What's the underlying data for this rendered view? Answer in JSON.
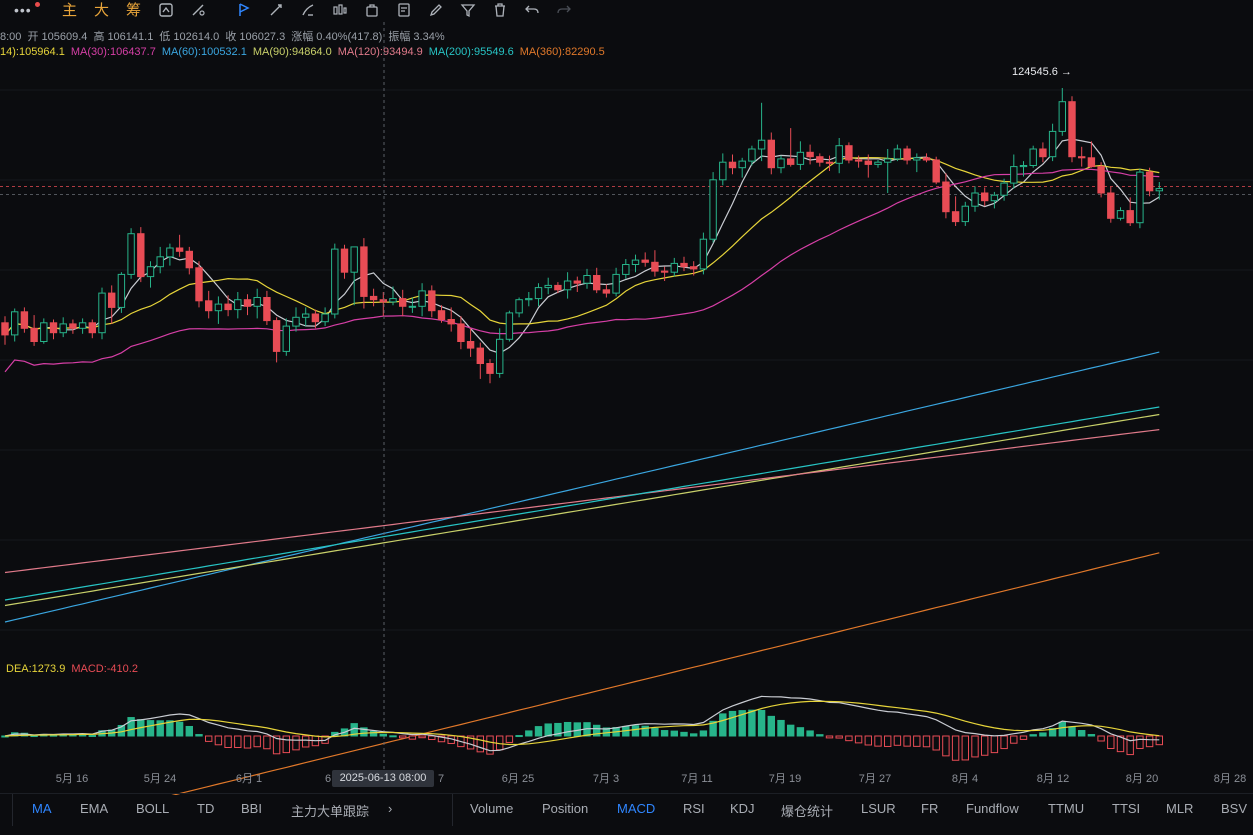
{
  "toolbar": {
    "more_label": "•••",
    "cn_items": [
      "主",
      "大",
      "筹"
    ],
    "icons": [
      "target-icon",
      "pen-line-icon",
      "indicator-icon",
      "draw-line-icon",
      "magnet-icon",
      "ruler-icon",
      "highlighter-icon",
      "candles-icon",
      "bag-icon",
      "note-icon",
      "pencil-icon",
      "filter-icon",
      "trash-icon",
      "undo-icon",
      "redo-icon"
    ]
  },
  "ohlc": {
    "time": "8:00",
    "open_label": "开",
    "open": "105609.4",
    "high_label": "高",
    "high": "106141.1",
    "low_label": "低",
    "low": "102614.0",
    "close_label": "收",
    "close": "106027.3",
    "change_label": "涨幅",
    "change": "0.40%(417.8)",
    "amp_label": "振幅",
    "amp": "3.34%"
  },
  "ma_legend": [
    {
      "label": "14):105964.1",
      "color": "#e6d43a"
    },
    {
      "label": "MA(30):106437.7",
      "color": "#d63fa6"
    },
    {
      "label": "MA(60):100532.1",
      "color": "#3aa6e0"
    },
    {
      "label": "MA(90):94864.0",
      "color": "#c8d06a"
    },
    {
      "label": "MA(120):93494.9",
      "color": "#e07a8a"
    },
    {
      "label": "MA(200):95549.6",
      "color": "#27c4c4"
    },
    {
      "label": "MA(360):82290.5",
      "color": "#e0782a"
    }
  ],
  "macd_legend": [
    {
      "label": "DEA:1273.9",
      "color": "#e6d43a"
    },
    {
      "label": "MACD:-410.2",
      "color": "#e84c55"
    }
  ],
  "peak_label": "124545.6 →",
  "crosshair_date": "2025-06-13 08:00",
  "chart_data": {
    "type": "candlestick",
    "x_labels": [
      "5月 16",
      "5月 24",
      "6月 1",
      "6",
      "7",
      "6月 25",
      "7月 3",
      "7月 11",
      "7月 19",
      "7月 27",
      "8月 4",
      "8月 12",
      "8月 20",
      "8月 28"
    ],
    "ma_current": [
      {
        "name": "MA(30)",
        "value": 106437.7
      },
      {
        "name": "MA(60)",
        "value": 100532.1
      },
      {
        "name": "MA(90)",
        "value": 94864.0
      },
      {
        "name": "MA(120)",
        "value": 93494.9
      },
      {
        "name": "MA(200)",
        "value": 95549.6
      },
      {
        "name": "MA(360)",
        "value": 82290.5
      }
    ],
    "last_candle": {
      "open": 105609.4,
      "high": 106141.1,
      "low": 102614.0,
      "close": 106027.3
    },
    "high_marker": 124545.6,
    "candles": [
      [
        103200,
        103800,
        101200,
        102100
      ],
      [
        102100,
        104500,
        101500,
        104200
      ],
      [
        104200,
        104600,
        102300,
        102700
      ],
      [
        102700,
        103900,
        101100,
        101500
      ],
      [
        101500,
        103600,
        101300,
        103200
      ],
      [
        103200,
        103500,
        101700,
        102300
      ],
      [
        102300,
        103700,
        101900,
        103100
      ],
      [
        103100,
        103500,
        102200,
        102700
      ],
      [
        102700,
        103600,
        102200,
        103200
      ],
      [
        103200,
        103500,
        101800,
        102300
      ],
      [
        102300,
        106400,
        101700,
        105900
      ],
      [
        105900,
        106600,
        103100,
        104600
      ],
      [
        104600,
        107800,
        104100,
        107600
      ],
      [
        107600,
        111800,
        107200,
        111300
      ],
      [
        111300,
        111900,
        106900,
        107400
      ],
      [
        107400,
        108800,
        106400,
        108300
      ],
      [
        108300,
        110100,
        107700,
        109200
      ],
      [
        109200,
        110400,
        108400,
        110000
      ],
      [
        110000,
        111200,
        109200,
        109700
      ],
      [
        109700,
        110100,
        107600,
        108200
      ],
      [
        108200,
        108800,
        104600,
        105200
      ],
      [
        105200,
        106100,
        103600,
        104300
      ],
      [
        104300,
        105600,
        103100,
        104900
      ],
      [
        104900,
        105700,
        103800,
        104400
      ],
      [
        104400,
        106000,
        103600,
        105300
      ],
      [
        105300,
        105800,
        103900,
        104700
      ],
      [
        104700,
        106300,
        103600,
        105500
      ],
      [
        105500,
        106100,
        103000,
        103400
      ],
      [
        103400,
        103700,
        99600,
        100600
      ],
      [
        100600,
        103600,
        100200,
        102900
      ],
      [
        102900,
        104600,
        102400,
        103700
      ],
      [
        103700,
        104600,
        102900,
        104000
      ],
      [
        104000,
        104400,
        102700,
        103300
      ],
      [
        103300,
        104600,
        102900,
        104000
      ],
      [
        104000,
        110400,
        103600,
        109900
      ],
      [
        109900,
        110300,
        107200,
        107800
      ],
      [
        107800,
        108500,
        104800,
        110100
      ],
      [
        110100,
        110900,
        104500,
        105600
      ],
      [
        105600,
        106300,
        104700,
        105300
      ],
      [
        105300,
        106000,
        103800,
        105100
      ],
      [
        105100,
        106500,
        104800,
        105400
      ],
      [
        105400,
        106200,
        103800,
        104700
      ],
      [
        104700,
        105500,
        104100,
        104700
      ],
      [
        104700,
        106800,
        103800,
        106100
      ],
      [
        106100,
        106600,
        103700,
        104300
      ],
      [
        104300,
        104800,
        103200,
        103500
      ],
      [
        103500,
        104600,
        102400,
        103100
      ],
      [
        103100,
        103800,
        100800,
        101500
      ],
      [
        101500,
        102700,
        100100,
        100900
      ],
      [
        100900,
        101400,
        98100,
        99500
      ],
      [
        99500,
        99900,
        97700,
        98600
      ],
      [
        98600,
        102700,
        98200,
        101700
      ],
      [
        101700,
        104300,
        101500,
        104100
      ],
      [
        104100,
        105500,
        103700,
        105300
      ],
      [
        105300,
        106000,
        104700,
        105400
      ],
      [
        105400,
        106800,
        104700,
        106400
      ],
      [
        106400,
        107300,
        105800,
        106600
      ],
      [
        106600,
        106900,
        105900,
        106200
      ],
      [
        106200,
        107800,
        105400,
        107000
      ],
      [
        107000,
        107400,
        106000,
        106800
      ],
      [
        106800,
        108100,
        106300,
        107500
      ],
      [
        107500,
        108200,
        105900,
        106200
      ],
      [
        106200,
        106700,
        105500,
        105900
      ],
      [
        105900,
        108200,
        105600,
        107600
      ],
      [
        107600,
        109000,
        107200,
        108500
      ],
      [
        108500,
        109400,
        107800,
        108900
      ],
      [
        108900,
        109600,
        108300,
        108700
      ],
      [
        108700,
        109800,
        107400,
        107900
      ],
      [
        107900,
        108300,
        107000,
        107800
      ],
      [
        107800,
        109100,
        107400,
        108600
      ],
      [
        108600,
        109200,
        107900,
        108300
      ],
      [
        108300,
        108800,
        107500,
        108100
      ],
      [
        108100,
        111400,
        107600,
        110800
      ],
      [
        110800,
        116900,
        110500,
        116200
      ],
      [
        116200,
        118600,
        115700,
        117800
      ],
      [
        117800,
        118500,
        116700,
        117300
      ],
      [
        117300,
        118200,
        116400,
        117900
      ],
      [
        117900,
        119300,
        117500,
        119000
      ],
      [
        119000,
        123200,
        117900,
        119800
      ],
      [
        119800,
        120500,
        116700,
        117300
      ],
      [
        117300,
        118400,
        116800,
        118100
      ],
      [
        118100,
        120900,
        117400,
        117600
      ],
      [
        117600,
        119700,
        117100,
        118700
      ],
      [
        118700,
        119400,
        117600,
        118300
      ],
      [
        118300,
        118600,
        117400,
        117800
      ],
      [
        117800,
        118400,
        117000,
        117700
      ],
      [
        117700,
        120000,
        116800,
        119300
      ],
      [
        119300,
        119600,
        117700,
        118000
      ],
      [
        118000,
        118400,
        117300,
        117900
      ],
      [
        117900,
        118500,
        116400,
        117600
      ],
      [
        117600,
        118000,
        117300,
        117800
      ],
      [
        117800,
        119000,
        115000,
        118100
      ],
      [
        118100,
        119400,
        117900,
        119000
      ],
      [
        119000,
        119300,
        117600,
        118000
      ],
      [
        118000,
        118600,
        116900,
        118200
      ],
      [
        118200,
        118600,
        117800,
        118000
      ],
      [
        118000,
        118300,
        115800,
        116000
      ],
      [
        116000,
        116800,
        112700,
        113300
      ],
      [
        113300,
        114700,
        112000,
        112400
      ],
      [
        112400,
        114200,
        112000,
        113800
      ],
      [
        113800,
        115600,
        113300,
        115000
      ],
      [
        115000,
        115500,
        113800,
        114300
      ],
      [
        114300,
        115100,
        113600,
        114800
      ],
      [
        114800,
        116300,
        114300,
        115900
      ],
      [
        115900,
        118500,
        115400,
        117400
      ],
      [
        117400,
        117900,
        116500,
        117500
      ],
      [
        117500,
        119300,
        117300,
        119000
      ],
      [
        119000,
        119600,
        117800,
        118300
      ],
      [
        118300,
        121300,
        117900,
        120600
      ],
      [
        120600,
        124545.6,
        120200,
        123300
      ],
      [
        123300,
        123800,
        117800,
        118300
      ],
      [
        118300,
        119200,
        117400,
        118200
      ],
      [
        118200,
        119700,
        117300,
        117400
      ],
      [
        117400,
        117800,
        114600,
        115000
      ],
      [
        115000,
        115600,
        112300,
        112700
      ],
      [
        112700,
        113700,
        112500,
        113400
      ],
      [
        113400,
        114600,
        112000,
        112300
      ],
      [
        112300,
        117200,
        111800,
        116900
      ],
      [
        116900,
        117300,
        114700,
        115200
      ],
      [
        115200,
        116000,
        114400,
        115400
      ]
    ]
  },
  "bottom_bar": {
    "left": [
      "MA",
      "EMA",
      "BOLL",
      "TD",
      "BBI",
      "主力大单跟踪"
    ],
    "arrow": "›",
    "right": [
      "Volume",
      "Position",
      "MACD",
      "RSI",
      "KDJ",
      "爆仓统计",
      "LSUR",
      "FR",
      "Fundflow",
      "TTMU",
      "TTSI",
      "MLR",
      "BSV"
    ]
  }
}
